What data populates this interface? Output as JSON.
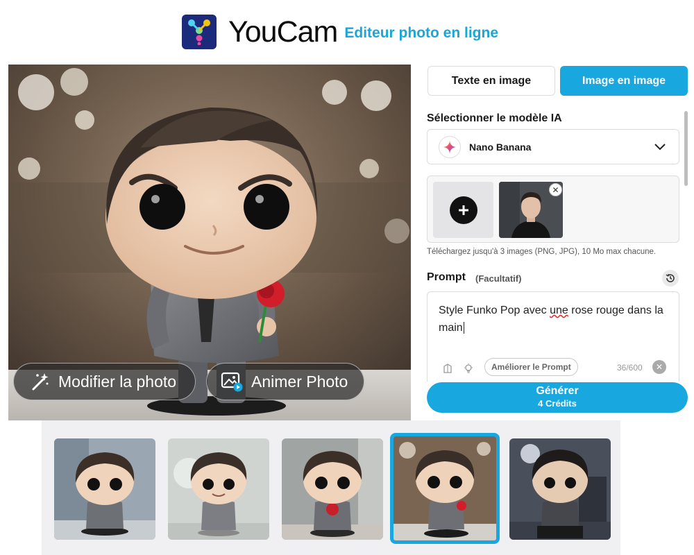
{
  "header": {
    "brand": "YouCam",
    "tagline": "Editeur photo en ligne",
    "logo_icon": "youcam-logo-icon"
  },
  "preview": {
    "modify_label": "Modifier la photo",
    "animate_label": "Animer Photo"
  },
  "tabs": [
    {
      "label": "Texte en image",
      "active": false
    },
    {
      "label": "Image en image",
      "active": true
    }
  ],
  "model": {
    "section_title": "Sélectionner le modèle IA",
    "selected": "Nano Banana"
  },
  "upload": {
    "hint": "Téléchargez jusqu'à 3 images (PNG, JPG), 10 Mo max chacune."
  },
  "prompt": {
    "label": "Prompt",
    "optional": "(Facultatif)",
    "text_before": "Style Funko Pop avec ",
    "text_squiggle": "une",
    "text_after": " rose rouge dans la main",
    "improve_label": "Améliorer le Prompt",
    "counter": "36/600"
  },
  "generate": {
    "label": "Générer",
    "credits": "4 Crédits"
  },
  "results": {
    "selected_index": 3,
    "count": 5
  },
  "colors": {
    "accent": "#19a7e0",
    "brand_text": "#19a7d9"
  }
}
